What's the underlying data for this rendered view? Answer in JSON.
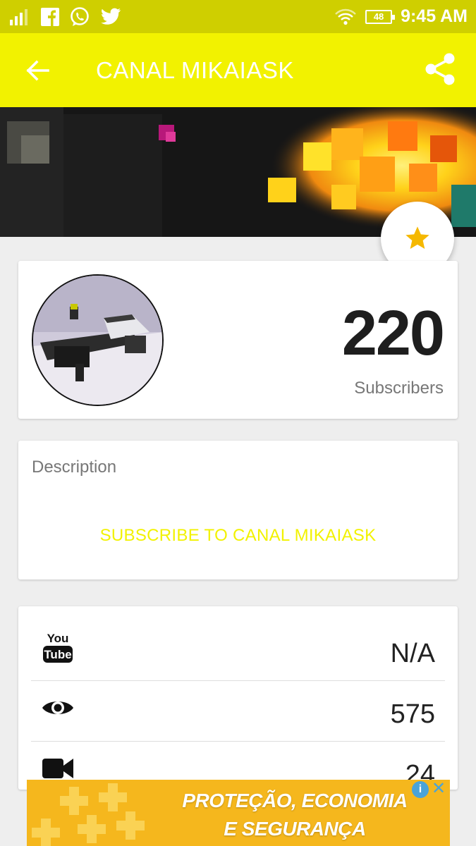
{
  "status_bar": {
    "time": "9:45 AM",
    "battery": "48",
    "icons": [
      "signal-icon",
      "facebook-icon",
      "whatsapp-icon",
      "twitter-icon",
      "wifi-icon",
      "battery-icon"
    ]
  },
  "app_bar": {
    "title": "CANAL MIKAIASK",
    "back_icon": "arrow-back-icon",
    "share_icon": "share-icon"
  },
  "favorite": {
    "icon": "star-icon"
  },
  "channel": {
    "subscriber_count": "220",
    "subscriber_label": "Subscribers"
  },
  "description": {
    "label": "Description",
    "cta": "SUBSCRIBE TO CANAL MIKAIASK"
  },
  "stats": [
    {
      "icon": "youtube-icon",
      "value": "N/A"
    },
    {
      "icon": "eye-icon",
      "value": "575"
    },
    {
      "icon": "video-camera-icon",
      "value": "24"
    }
  ],
  "ad": {
    "line1": "PROTEÇÃO, ECONOMIA",
    "line2": "E SEGURANÇA",
    "info": "i",
    "close": "✕"
  },
  "colors": {
    "accent": "#f2f200",
    "status_bar": "#cfcf00",
    "star": "#f5b800",
    "ad_bg": "#f5b71d"
  }
}
